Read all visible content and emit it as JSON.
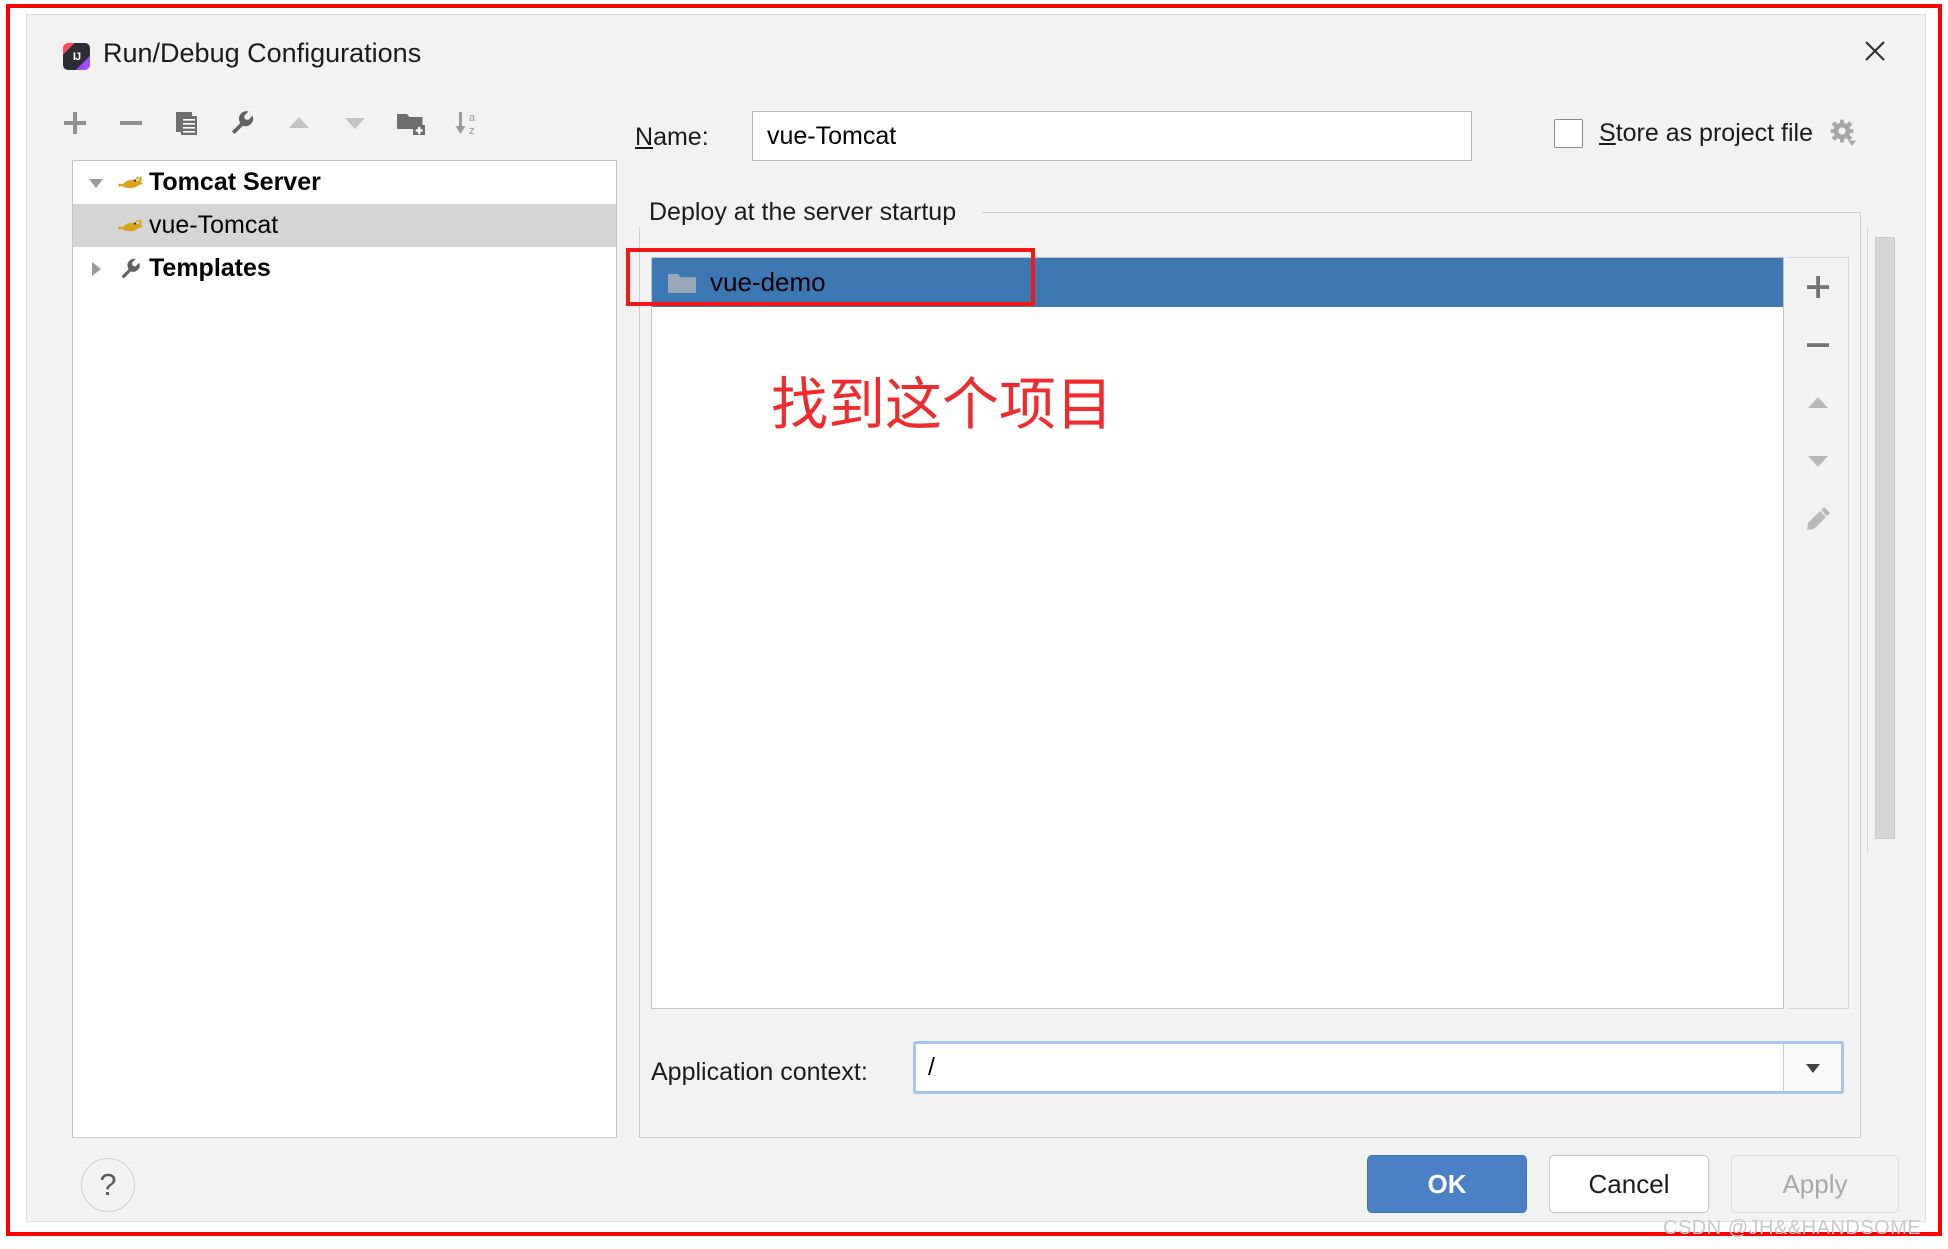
{
  "window": {
    "title": "Run/Debug Configurations",
    "app_icon": "intellij-idea-icon",
    "close_icon": "close-icon"
  },
  "left_toolbar": {
    "buttons": [
      {
        "name": "add-configuration-button",
        "icon": "plus-icon",
        "tooltip": "Add New Configuration"
      },
      {
        "name": "remove-configuration-button",
        "icon": "minus-icon",
        "tooltip": "Remove Configuration"
      },
      {
        "name": "copy-configuration-button",
        "icon": "copy-icon",
        "tooltip": "Copy Configuration"
      },
      {
        "name": "edit-templates-button",
        "icon": "wrench-icon",
        "tooltip": "Edit Templates"
      },
      {
        "name": "move-up-button",
        "icon": "arrow-up-icon",
        "tooltip": "Move Up"
      },
      {
        "name": "move-down-button",
        "icon": "arrow-down-icon",
        "tooltip": "Move Down"
      },
      {
        "name": "new-folder-button",
        "icon": "new-folder-icon",
        "tooltip": "Create New Folder"
      },
      {
        "name": "sort-button",
        "icon": "sort-az-icon",
        "tooltip": "Sort Configurations"
      }
    ]
  },
  "tree": {
    "items": [
      {
        "label": "Tomcat Server",
        "icon": "tomcat-cat-icon",
        "expanded": true,
        "selected": false,
        "bold": true,
        "indent": false,
        "toggle": "chevron-down-icon"
      },
      {
        "label": "vue-Tomcat",
        "icon": "tomcat-cat-icon",
        "expanded": false,
        "selected": true,
        "bold": false,
        "indent": true,
        "toggle": ""
      },
      {
        "label": "Templates",
        "icon": "wrench-icon",
        "expanded": false,
        "selected": false,
        "bold": true,
        "indent": false,
        "toggle": "chevron-right-icon"
      }
    ]
  },
  "name_row": {
    "label": "Name:",
    "label_mnemonic": "N",
    "label_rest": "ame:",
    "value": "vue-Tomcat",
    "placeholder": ""
  },
  "store_as_project_file": {
    "label": "Store as project file",
    "label_mnemonic": "S",
    "label_rest": "tore as project file",
    "checked": false,
    "gear_icon": "gear-icon"
  },
  "deploy_section": {
    "legend": "Deploy at the server startup",
    "items": [
      {
        "label": "vue-demo",
        "icon": "folder-icon",
        "selected": true
      }
    ],
    "toolbar": [
      {
        "name": "deploy-add-button",
        "icon": "plus-icon"
      },
      {
        "name": "deploy-remove-button",
        "icon": "minus-icon"
      },
      {
        "name": "deploy-moveup-button",
        "icon": "arrow-up-icon"
      },
      {
        "name": "deploy-movedown-button",
        "icon": "arrow-down-icon"
      },
      {
        "name": "deploy-edit-button",
        "icon": "pencil-icon"
      }
    ]
  },
  "application_context": {
    "label": "Application context:",
    "value": "/",
    "placeholder": "",
    "dropdown_icon": "chevron-down-icon"
  },
  "annotations": {
    "chinese_note": "找到这个项目",
    "highlight_color": "#f01818",
    "note_color": "#ef2b2b"
  },
  "footer": {
    "help_label": "?",
    "ok_label": "OK",
    "cancel_label": "Cancel",
    "apply_label": "Apply"
  },
  "watermark": "CSDN @JH&&HANDSOME",
  "colors": {
    "selection_blue": "#3c78b4",
    "primary_button": "#4a81c4",
    "tree_selection": "#d5d5d5",
    "dialog_bg": "#f2f2f2",
    "annotation_red": "#f01818"
  }
}
